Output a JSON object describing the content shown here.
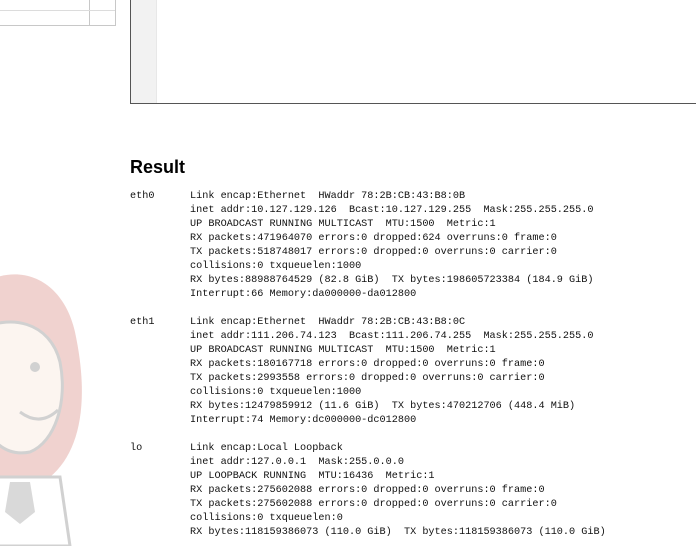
{
  "result": {
    "heading": "Result",
    "interfaces": [
      {
        "name": "eth0",
        "lines": [
          "Link encap:Ethernet  HWaddr 78:2B:CB:43:B8:0B",
          "inet addr:10.127.129.126  Bcast:10.127.129.255  Mask:255.255.255.0",
          "UP BROADCAST RUNNING MULTICAST  MTU:1500  Metric:1",
          "RX packets:471964070 errors:0 dropped:624 overruns:0 frame:0",
          "TX packets:518748017 errors:0 dropped:0 overruns:0 carrier:0",
          "collisions:0 txqueuelen:1000",
          "RX bytes:88988764529 (82.8 GiB)  TX bytes:198605723384 (184.9 GiB)",
          "Interrupt:66 Memory:da000000-da012800"
        ]
      },
      {
        "name": "eth1",
        "lines": [
          "Link encap:Ethernet  HWaddr 78:2B:CB:43:B8:0C",
          "inet addr:111.206.74.123  Bcast:111.206.74.255  Mask:255.255.255.0",
          "UP BROADCAST RUNNING MULTICAST  MTU:1500  Metric:1",
          "RX packets:180167718 errors:0 dropped:0 overruns:0 frame:0",
          "TX packets:2993558 errors:0 dropped:0 overruns:0 carrier:0",
          "collisions:0 txqueuelen:1000",
          "RX bytes:12479859912 (11.6 GiB)  TX bytes:470212706 (448.4 MiB)",
          "Interrupt:74 Memory:dc000000-dc012800"
        ]
      },
      {
        "name": "lo",
        "lines": [
          "Link encap:Local Loopback",
          "inet addr:127.0.0.1  Mask:255.0.0.0",
          "UP LOOPBACK RUNNING  MTU:16436  Metric:1",
          "RX packets:275602088 errors:0 dropped:0 overruns:0 frame:0",
          "TX packets:275602088 errors:0 dropped:0 overruns:0 carrier:0",
          "collisions:0 txqueuelen:0",
          "RX bytes:118159386073 (110.0 GiB)  TX bytes:118159386073 (110.0 GiB)"
        ]
      }
    ]
  },
  "colors": {
    "mascot_red": "#c0392b",
    "console_border": "#555555"
  }
}
